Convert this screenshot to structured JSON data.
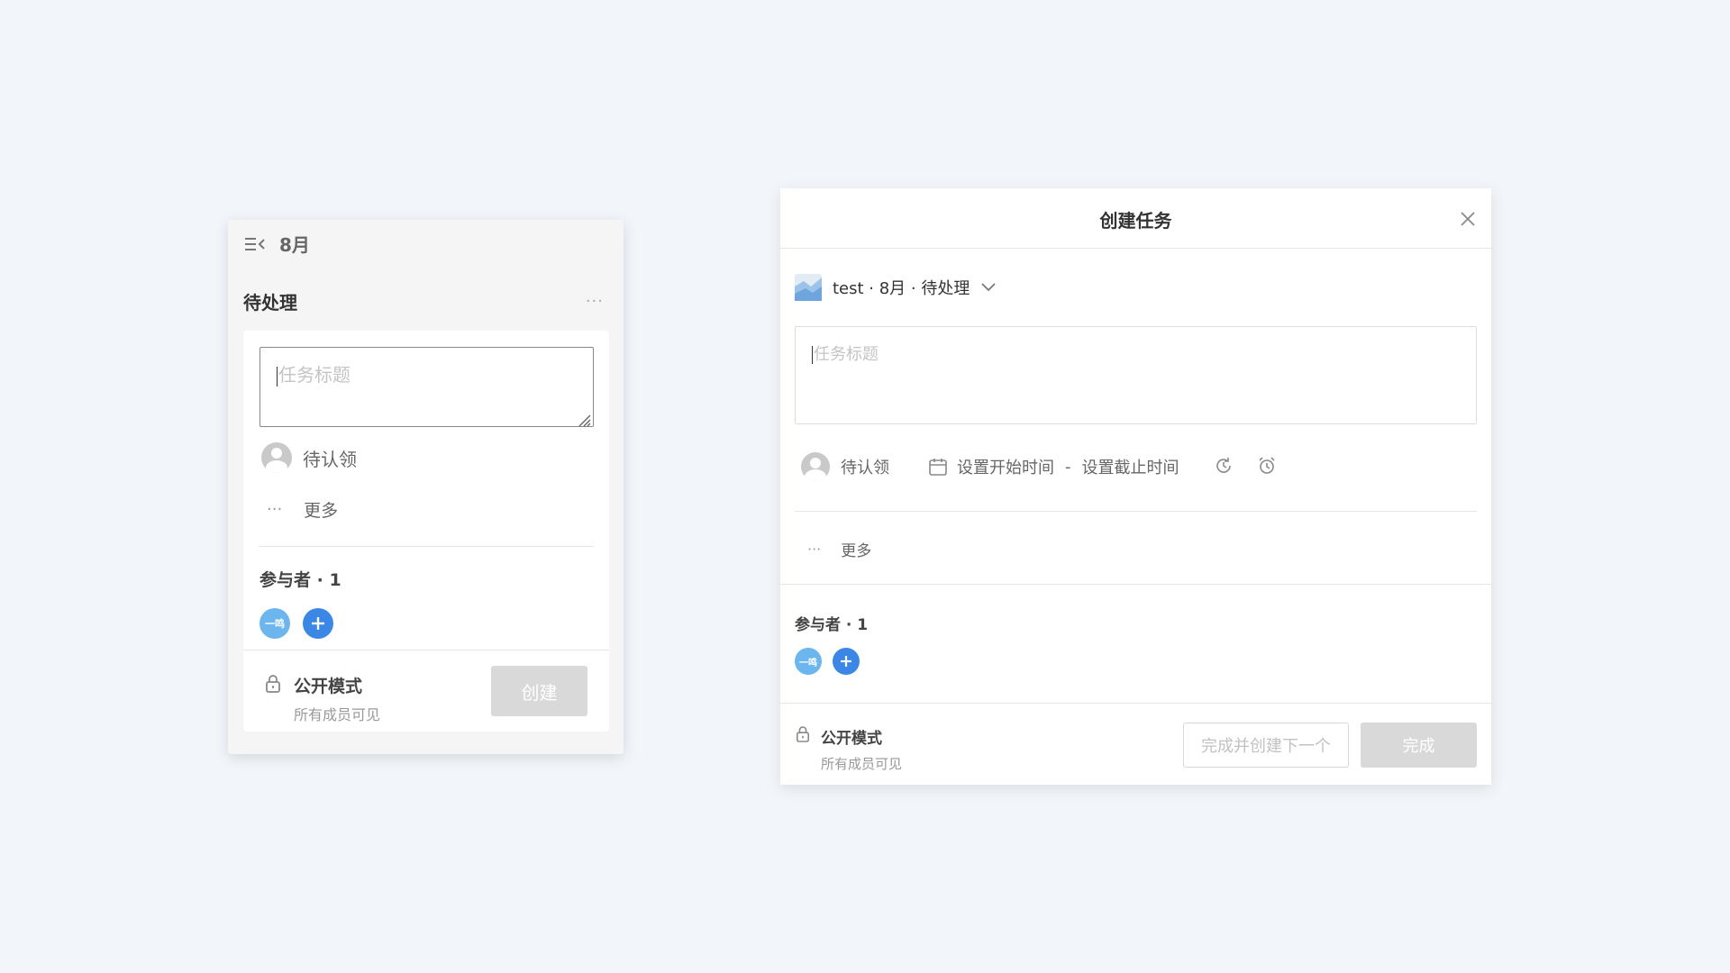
{
  "left_column": {
    "month": "8月",
    "column_title": "待处理",
    "more_dots": "···",
    "card": {
      "title_placeholder": "任务标题",
      "assignee_label": "待认领",
      "more_dots": "···",
      "more_label": "更多",
      "participants_label": "参与者 · 1",
      "member_avatar_text": "一鸣",
      "mode_title": "公开模式",
      "mode_subtitle": "所有成员可见",
      "create_button": "创建"
    }
  },
  "dialog": {
    "title": "创建任务",
    "project_path": "test · 8月 · 待处理",
    "title_placeholder": "任务标题",
    "assignee_label": "待认领",
    "start_time_label": "设置开始时间",
    "time_separator": "-",
    "due_time_label": "设置截止时间",
    "more_dots": "···",
    "more_label": "更多",
    "participants_label": "参与者 · 1",
    "member_avatar_text": "一鸣",
    "mode_title": "公开模式",
    "mode_subtitle": "所有成员可见",
    "create_next_button": "完成并创建下一个",
    "done_button": "完成"
  },
  "colors": {
    "background": "#f2f6fa",
    "accent_blue": "#3b87e8",
    "member_avatar": "#6bb6ee",
    "disabled_button": "#d9d9d9"
  }
}
